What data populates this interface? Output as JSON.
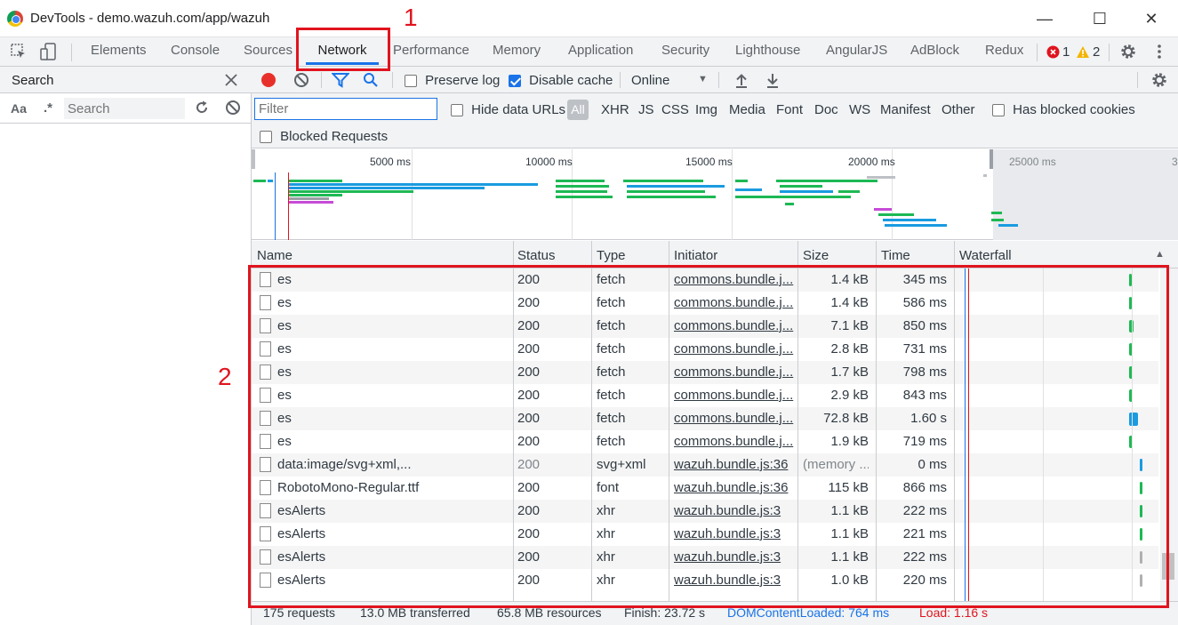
{
  "window": {
    "title": "DevTools - demo.wazuh.com/app/wazuh",
    "minimize": "—",
    "maximize": "☐",
    "close": "✕"
  },
  "tabs": [
    "Elements",
    "Console",
    "Sources",
    "Network",
    "Performance",
    "Memory",
    "Application",
    "Security",
    "Lighthouse",
    "AngularJS",
    "AdBlock",
    "Redux"
  ],
  "active_tab": "Network",
  "issues": {
    "errors": "1",
    "warnings": "2"
  },
  "search": {
    "title": "Search",
    "case_label": "Aa",
    "regex_label": ".*",
    "placeholder": "Search"
  },
  "toolbar": {
    "preserve_log": "Preserve log",
    "disable_cache": "Disable cache",
    "throttle": "Online"
  },
  "filter": {
    "placeholder": "Filter",
    "hide_data_urls": "Hide data URLs",
    "types": [
      "All",
      "XHR",
      "JS",
      "CSS",
      "Img",
      "Media",
      "Font",
      "Doc",
      "WS",
      "Manifest",
      "Other"
    ],
    "has_blocked_cookies": "Has blocked cookies",
    "blocked_requests": "Blocked Requests"
  },
  "overview": {
    "ticks": [
      "5000 ms",
      "10000 ms",
      "15000 ms",
      "20000 ms",
      "25000 ms",
      "3"
    ]
  },
  "columns": [
    "Name",
    "Status",
    "Type",
    "Initiator",
    "Size",
    "Time",
    "Waterfall"
  ],
  "rows": [
    {
      "name": "es",
      "status": "200",
      "type": "fetch",
      "initiator": "commons.bundle.j...",
      "size": "1.4 kB",
      "time": "345 ms",
      "wf": 0.935,
      "ww": 0.008,
      "wc": "#1db954"
    },
    {
      "name": "es",
      "status": "200",
      "type": "fetch",
      "initiator": "commons.bundle.j...",
      "size": "1.4 kB",
      "time": "586 ms",
      "wf": 0.935,
      "ww": 0.012,
      "wc": "#1db954"
    },
    {
      "name": "es",
      "status": "200",
      "type": "fetch",
      "initiator": "commons.bundle.j...",
      "size": "7.1 kB",
      "time": "850 ms",
      "wf": 0.935,
      "ww": 0.02,
      "wc": "#1db954"
    },
    {
      "name": "es",
      "status": "200",
      "type": "fetch",
      "initiator": "commons.bundle.j...",
      "size": "2.8 kB",
      "time": "731 ms",
      "wf": 0.935,
      "ww": 0.016,
      "wc": "#1db954"
    },
    {
      "name": "es",
      "status": "200",
      "type": "fetch",
      "initiator": "commons.bundle.j...",
      "size": "1.7 kB",
      "time": "798 ms",
      "wf": 0.935,
      "ww": 0.016,
      "wc": "#1db954"
    },
    {
      "name": "es",
      "status": "200",
      "type": "fetch",
      "initiator": "commons.bundle.j...",
      "size": "2.9 kB",
      "time": "843 ms",
      "wf": 0.935,
      "ww": 0.016,
      "wc": "#1db954"
    },
    {
      "name": "es",
      "status": "200",
      "type": "fetch",
      "initiator": "commons.bundle.j...",
      "size": "72.8 kB",
      "time": "1.60 s",
      "wf": 0.935,
      "ww": 0.045,
      "wc": "#1a9be0"
    },
    {
      "name": "es",
      "status": "200",
      "type": "fetch",
      "initiator": "commons.bundle.j...",
      "size": "1.9 kB",
      "time": "719 ms",
      "wf": 0.935,
      "ww": 0.016,
      "wc": "#1db954"
    },
    {
      "name": "data:image/svg+xml,...",
      "status": "200",
      "type": "svg+xml",
      "initiator": "wazuh.bundle.js:36",
      "size": "(memory ...",
      "time": "0 ms",
      "wf": 0.985,
      "ww": 0.006,
      "wc": "#1a9be0",
      "gray": true
    },
    {
      "name": "RobotoMono-Regular.ttf",
      "status": "200",
      "type": "font",
      "initiator": "wazuh.bundle.js:36",
      "size": "115 kB",
      "time": "866 ms",
      "wf": 0.985,
      "ww": 0.006,
      "wc": "#1db954"
    },
    {
      "name": "esAlerts",
      "status": "200",
      "type": "xhr",
      "initiator": "wazuh.bundle.js:3",
      "size": "1.1 kB",
      "time": "222 ms",
      "wf": 0.985,
      "ww": 0.006,
      "wc": "#1db954"
    },
    {
      "name": "esAlerts",
      "status": "200",
      "type": "xhr",
      "initiator": "wazuh.bundle.js:3",
      "size": "1.1 kB",
      "time": "221 ms",
      "wf": 0.985,
      "ww": 0.006,
      "wc": "#1db954"
    },
    {
      "name": "esAlerts",
      "status": "200",
      "type": "xhr",
      "initiator": "wazuh.bundle.js:3",
      "size": "1.1 kB",
      "time": "222 ms",
      "wf": 0.985,
      "ww": 0.006,
      "wc": "#b0b0b0"
    },
    {
      "name": "esAlerts",
      "status": "200",
      "type": "xhr",
      "initiator": "wazuh.bundle.js:3",
      "size": "1.0 kB",
      "time": "220 ms",
      "wf": 0.985,
      "ww": 0.006,
      "wc": "#b0b0b0"
    }
  ],
  "status_bar": {
    "requests": "175 requests",
    "transferred": "13.0 MB transferred",
    "resources": "65.8 MB resources",
    "finish": "Finish: 23.72 s",
    "dom_loaded": "DOMContentLoaded: 764 ms",
    "load": "Load: 1.16 s"
  },
  "annotations": {
    "label1": "1",
    "label2": "2",
    "color": "#e0141e"
  },
  "colors": {
    "accent": "#1a73e8",
    "record": "#e8302a",
    "error": "#e0141e",
    "warning": "#f5b400"
  }
}
